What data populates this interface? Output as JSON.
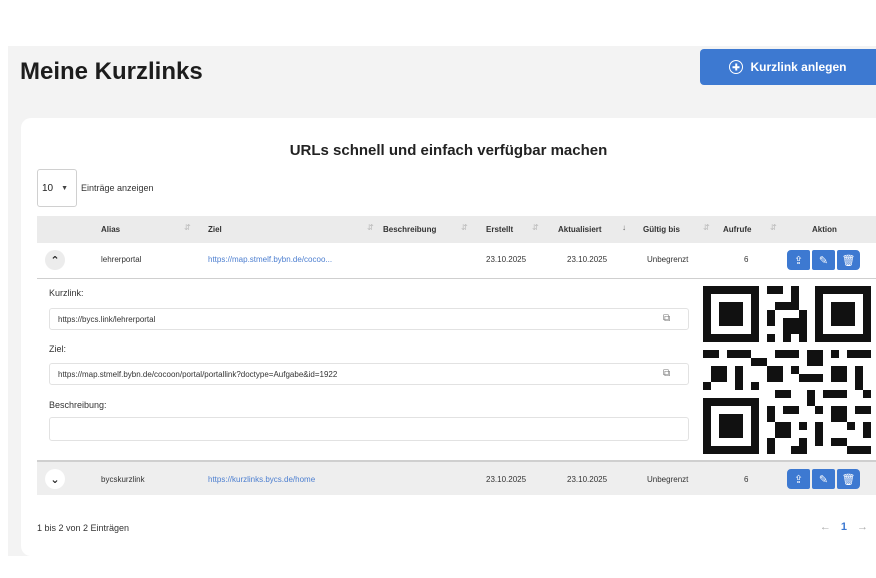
{
  "header": {
    "title": "Meine Kurzlinks",
    "add_label": "Kurzlink anlegen"
  },
  "card": {
    "title": "URLs schnell und einfach verfügbar machen"
  },
  "page_length": {
    "value": "10",
    "label": "Einträge anzeigen"
  },
  "columns": {
    "alias": "Alias",
    "ziel": "Ziel",
    "beschreibung": "Beschreibung",
    "erstellt": "Erstellt",
    "aktualisiert": "Aktualisiert",
    "gueltig": "Gültig bis",
    "aufrufe": "Aufrufe",
    "aktion": "Aktion"
  },
  "rows": [
    {
      "alias": "lehrerportal",
      "ziel": "https://map.stmelf.bybn.de/cocoo...",
      "erstellt": "23.10.2025",
      "aktualisiert": "23.10.2025",
      "gueltig": "Unbegrenzt",
      "aufrufe": "6"
    },
    {
      "alias": "bycskurzlink",
      "ziel": "https://kurzlinks.bycs.de/home",
      "erstellt": "23.10.2025",
      "aktualisiert": "23.10.2025",
      "gueltig": "Unbegrenzt",
      "aufrufe": "6"
    }
  ],
  "detail": {
    "kurzlink_label": "Kurzlink:",
    "kurzlink_value": "https://bycs.link/lehrerportal",
    "ziel_label": "Ziel:",
    "ziel_value": "https://map.stmelf.bybn.de/cocoon/portal/portallink?doctype=Aufgabe&id=1922",
    "beschreibung_label": "Beschreibung:",
    "beschreibung_value": ""
  },
  "footer": {
    "info": "1 bis 2 von 2 Einträgen",
    "current_page": "1"
  },
  "icons": {
    "expand": "chevron-up-icon",
    "collapse": "chevron-down-icon",
    "copy": "copy-icon",
    "share": "share-icon",
    "edit": "edit-icon",
    "delete": "trash-icon",
    "add": "plus-circle-icon"
  },
  "colors": {
    "primary": "#3d79d1",
    "link": "#4d7fd0"
  }
}
